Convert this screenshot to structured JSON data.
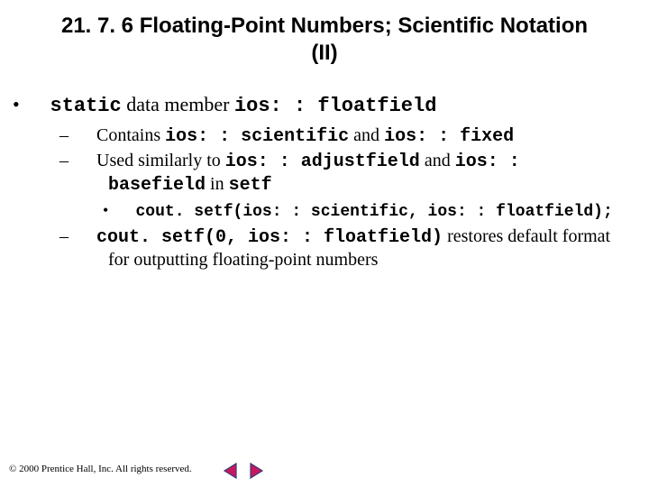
{
  "title": "21. 7. 6  Floating-Point Numbers; Scientific Notation (II)",
  "b1": {
    "pre": "static",
    "mid": " data member ",
    "post": "ios: : floatfield"
  },
  "b1a": {
    "t1": "Contains ",
    "c1": "ios: : scientific",
    "t2": " and ",
    "c2": "ios: : fixed"
  },
  "b1b": {
    "t1": "Used similarly to ",
    "c1": "ios: : adjustfield",
    "t2": " and ",
    "c2": "ios: : basefield",
    "t3": "  in ",
    "c3": "setf"
  },
  "b1b1": {
    "c1": "cout. setf(ios: : scientific, ios: : floatfield);"
  },
  "b1c": {
    "c1": "cout. setf(0, ios: : floatfield)",
    "t1": " restores default format for outputting floating-point numbers"
  },
  "footer": "© 2000 Prentice Hall, Inc.  All rights reserved.",
  "nav": {
    "back": "nav-back",
    "forward": "nav-forward"
  },
  "colors": {
    "navFill": "#c8175e",
    "navStroke": "#3a3a7a"
  }
}
